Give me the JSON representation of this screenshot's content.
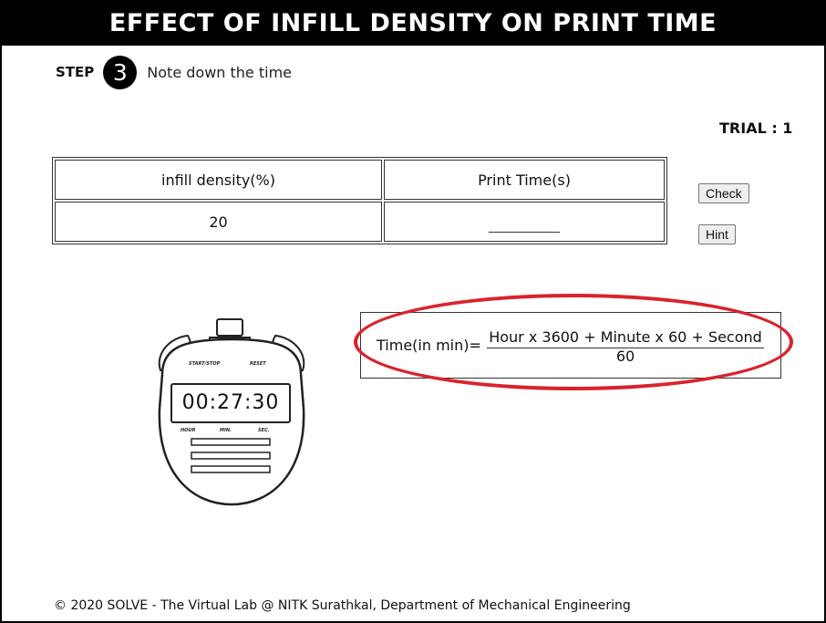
{
  "header": {
    "title": "EFFECT OF INFILL DENSITY ON PRINT TIME"
  },
  "step": {
    "label": "STEP",
    "number": "3",
    "instruction": "Note down the time"
  },
  "trial": {
    "text": "TRIAL : 1"
  },
  "table": {
    "headers": [
      "infill density(%)",
      "Print Time(s)"
    ],
    "rows": [
      {
        "density": "20",
        "print_time": ""
      }
    ]
  },
  "buttons": {
    "check": "Check",
    "hint": "Hint"
  },
  "formula": {
    "lhs": "Time(in min)=",
    "numerator": "Hour x 3600 + Minute x 60 + Second",
    "denominator": "60",
    "highlight_color": "#d9232d"
  },
  "stopwatch": {
    "display": "00:27:30",
    "start_stop_label": "START/STOP",
    "reset_label": "RESET",
    "hour_label": "HOUR",
    "min_label": "MIN.",
    "sec_label": "SEC."
  },
  "footer": {
    "text": "© 2020 SOLVE - The Virtual Lab @ NITK Surathkal, Department of Mechanical Engineering"
  }
}
